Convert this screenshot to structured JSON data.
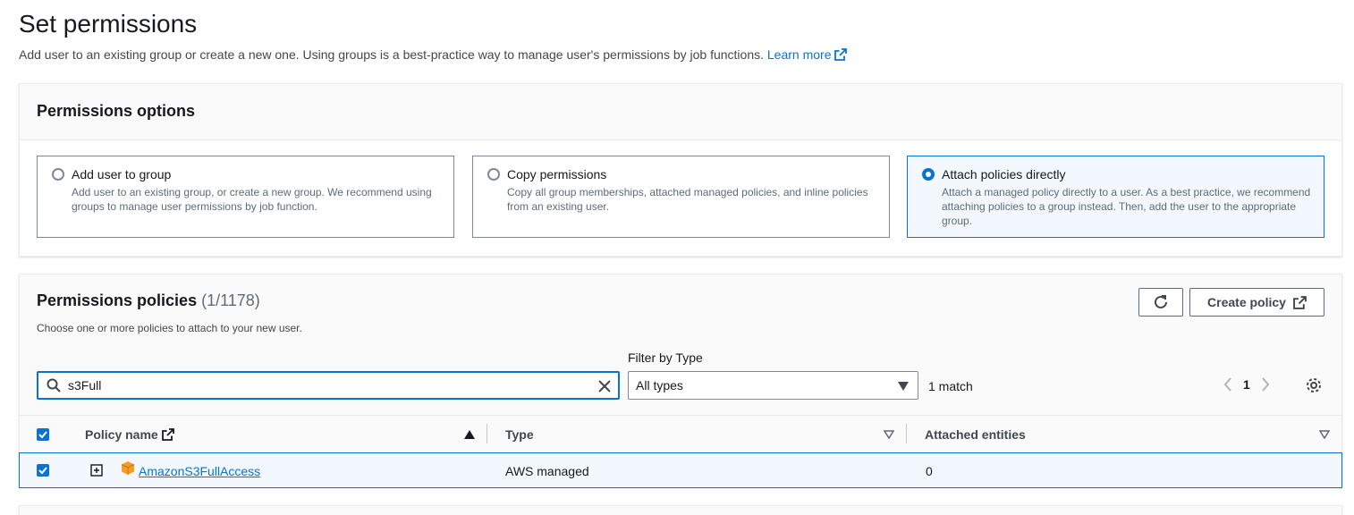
{
  "page": {
    "title": "Set permissions",
    "description": "Add user to an existing group or create a new one. Using groups is a best-practice way to manage user's permissions by job functions.",
    "learn_more": "Learn more"
  },
  "options": {
    "title": "Permissions options",
    "tiles": [
      {
        "label": "Add user to group",
        "desc": "Add user to an existing group, or create a new group. We recommend using groups to manage user permissions by job function.",
        "selected": false
      },
      {
        "label": "Copy permissions",
        "desc": "Copy all group memberships, attached managed policies, and inline policies from an existing user.",
        "selected": false
      },
      {
        "label": "Attach policies directly",
        "desc": "Attach a managed policy directly to a user. As a best practice, we recommend attaching policies to a group instead. Then, add the user to the appropriate group.",
        "selected": true
      }
    ]
  },
  "policies": {
    "title": "Permissions policies",
    "count": "(1/1178)",
    "description": "Choose one or more policies to attach to your new user.",
    "create_policy_label": "Create policy",
    "filter_label": "Filter by Type",
    "search_value": "s3Full",
    "filter_value": "All types",
    "match_text": "1 match",
    "page_number": "1",
    "columns": {
      "policy_name": "Policy name",
      "type": "Type",
      "attached_entities": "Attached entities"
    },
    "rows": [
      {
        "name": "AmazonS3FullAccess",
        "type": "AWS managed",
        "attached": "0",
        "checked": true
      }
    ]
  },
  "colors": {
    "accent": "#0972d3",
    "text": "#16191f",
    "secondary_text": "#5f6b7a",
    "aws_orange": "#f89c24"
  },
  "icons": [
    "external-link-icon",
    "refresh-icon",
    "search-icon",
    "clear-icon",
    "caret-down-icon",
    "chevron-left-icon",
    "chevron-right-icon",
    "settings-icon",
    "sort-asc-icon",
    "sort-icon",
    "expand-icon",
    "aws-package-icon",
    "check-icon"
  ]
}
